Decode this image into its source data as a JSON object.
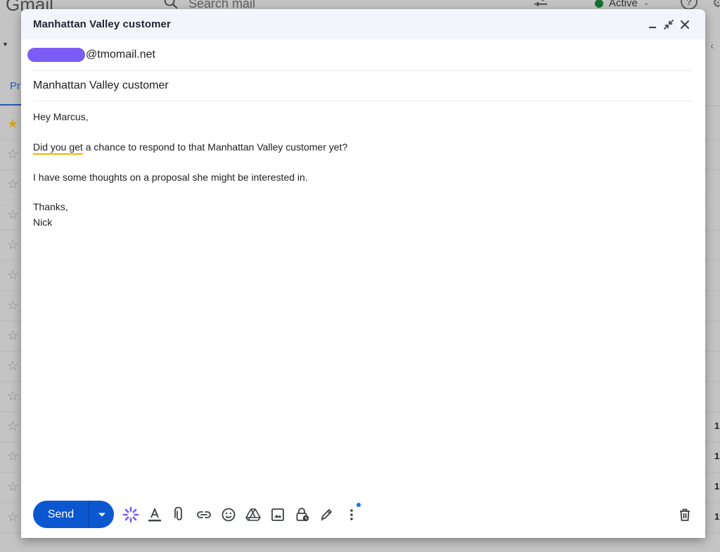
{
  "background": {
    "app_logo": "Gmail",
    "search_placeholder": "Search mail",
    "status_label": "Active",
    "tab_label": "Pr",
    "row_numbers": [
      "1:",
      "1:",
      "1",
      "1:"
    ]
  },
  "compose": {
    "window_title": "Manhattan Valley customer",
    "recipient_domain": "@tmomail.net",
    "subject": "Manhattan Valley customer",
    "body": {
      "greeting": "Hey Marcus,",
      "line1_underlined": "Did you get",
      "line1_rest": " a chance to respond to that Manhattan Valley customer yet?",
      "line2": "I have some thoughts on a proposal she might be interested in.",
      "signoff": "Thanks,",
      "signature": "Nick"
    },
    "send_label": "Send"
  },
  "colors": {
    "send_button": "#0b57d0",
    "header_bg": "#f2f6fc",
    "recipient_chip": "#7b5cf5",
    "spell_underline": "#f2b400",
    "notification_dot": "#1a73e8"
  },
  "icons": {
    "header": [
      "minimize-icon",
      "exit-fullscreen-icon",
      "close-icon"
    ],
    "toolbar": [
      "send-options-chevron-icon",
      "gemini-sparkle-icon",
      "text-format-icon",
      "attach-icon",
      "link-icon",
      "emoji-icon",
      "drive-icon",
      "photo-icon",
      "confidential-lock-icon",
      "signature-pen-icon",
      "more-options-icon",
      "trash-icon"
    ]
  }
}
